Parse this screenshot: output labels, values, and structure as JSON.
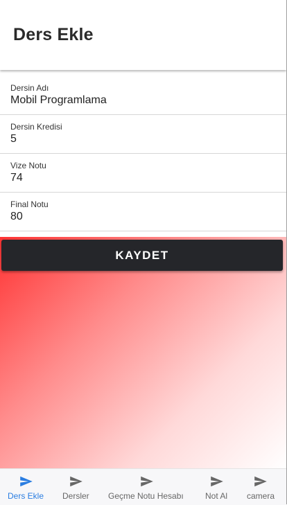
{
  "appbar": {
    "title": "Ders Ekle"
  },
  "form": {
    "fields": [
      {
        "label": "Dersin Adı",
        "value": "Mobil Programlama"
      },
      {
        "label": "Dersin Kredisi",
        "value": "5"
      },
      {
        "label": "Vize Notu",
        "value": "74"
      },
      {
        "label": "Final Notu",
        "value": "80"
      }
    ],
    "save_label": "KAYDET"
  },
  "background": {
    "gradient_from": "#ff3333",
    "gradient_to": "#ffffff"
  },
  "bottom_nav": {
    "active_color": "#2a7de1",
    "inactive_color": "#666666",
    "items": [
      {
        "label": "Ders Ekle",
        "icon": "send-icon",
        "active": true
      },
      {
        "label": "Dersler",
        "icon": "send-icon",
        "active": false
      },
      {
        "label": "Geçme Notu Hesabı",
        "icon": "send-icon",
        "active": false
      },
      {
        "label": "Not Al",
        "icon": "send-icon",
        "active": false
      },
      {
        "label": "camera",
        "icon": "send-icon",
        "active": false
      }
    ]
  }
}
